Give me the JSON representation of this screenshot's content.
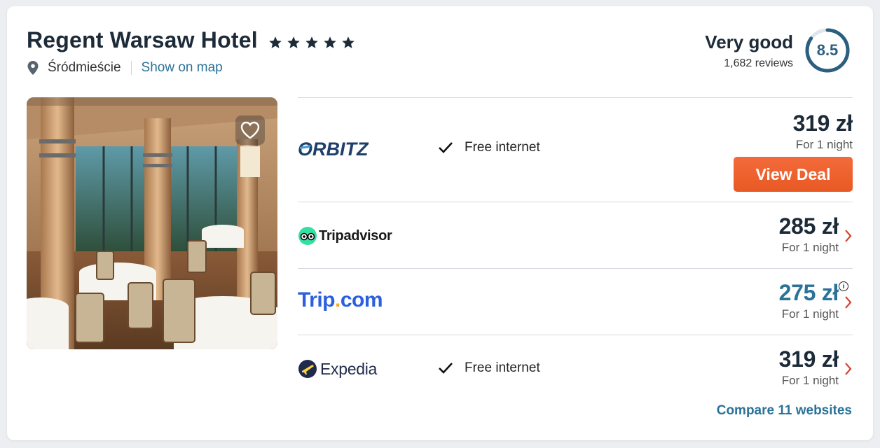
{
  "hotel": {
    "name": "Regent Warsaw Hotel",
    "star_count": 5,
    "district": "Śródmieście",
    "map_link": "Show on map"
  },
  "rating": {
    "label": "Very good",
    "reviews": "1,682 reviews",
    "score": "8.5",
    "score_fraction": 0.85
  },
  "deals": [
    {
      "provider": "ORBITZ",
      "amenity": "Free internet",
      "price": "319 zł",
      "per_night": "For 1 night",
      "cta": "View Deal"
    },
    {
      "provider": "Tripadvisor",
      "amenity": "",
      "price": "285 zł",
      "per_night": "For 1 night"
    },
    {
      "provider_parts": [
        "Trip",
        ".",
        "com"
      ],
      "amenity": "",
      "price": "275 zł",
      "per_night": "For 1 night",
      "info_symbol": "i"
    },
    {
      "provider": "Expedia",
      "amenity": "Free internet",
      "price": "319 zł",
      "per_night": "For 1 night"
    }
  ],
  "compare_link": "Compare 11 websites",
  "colors": {
    "accent_blue": "#2b7298",
    "cta_orange": "#e85a24",
    "score_ring": "#2b5f80",
    "chevron_red": "#d6452b"
  }
}
